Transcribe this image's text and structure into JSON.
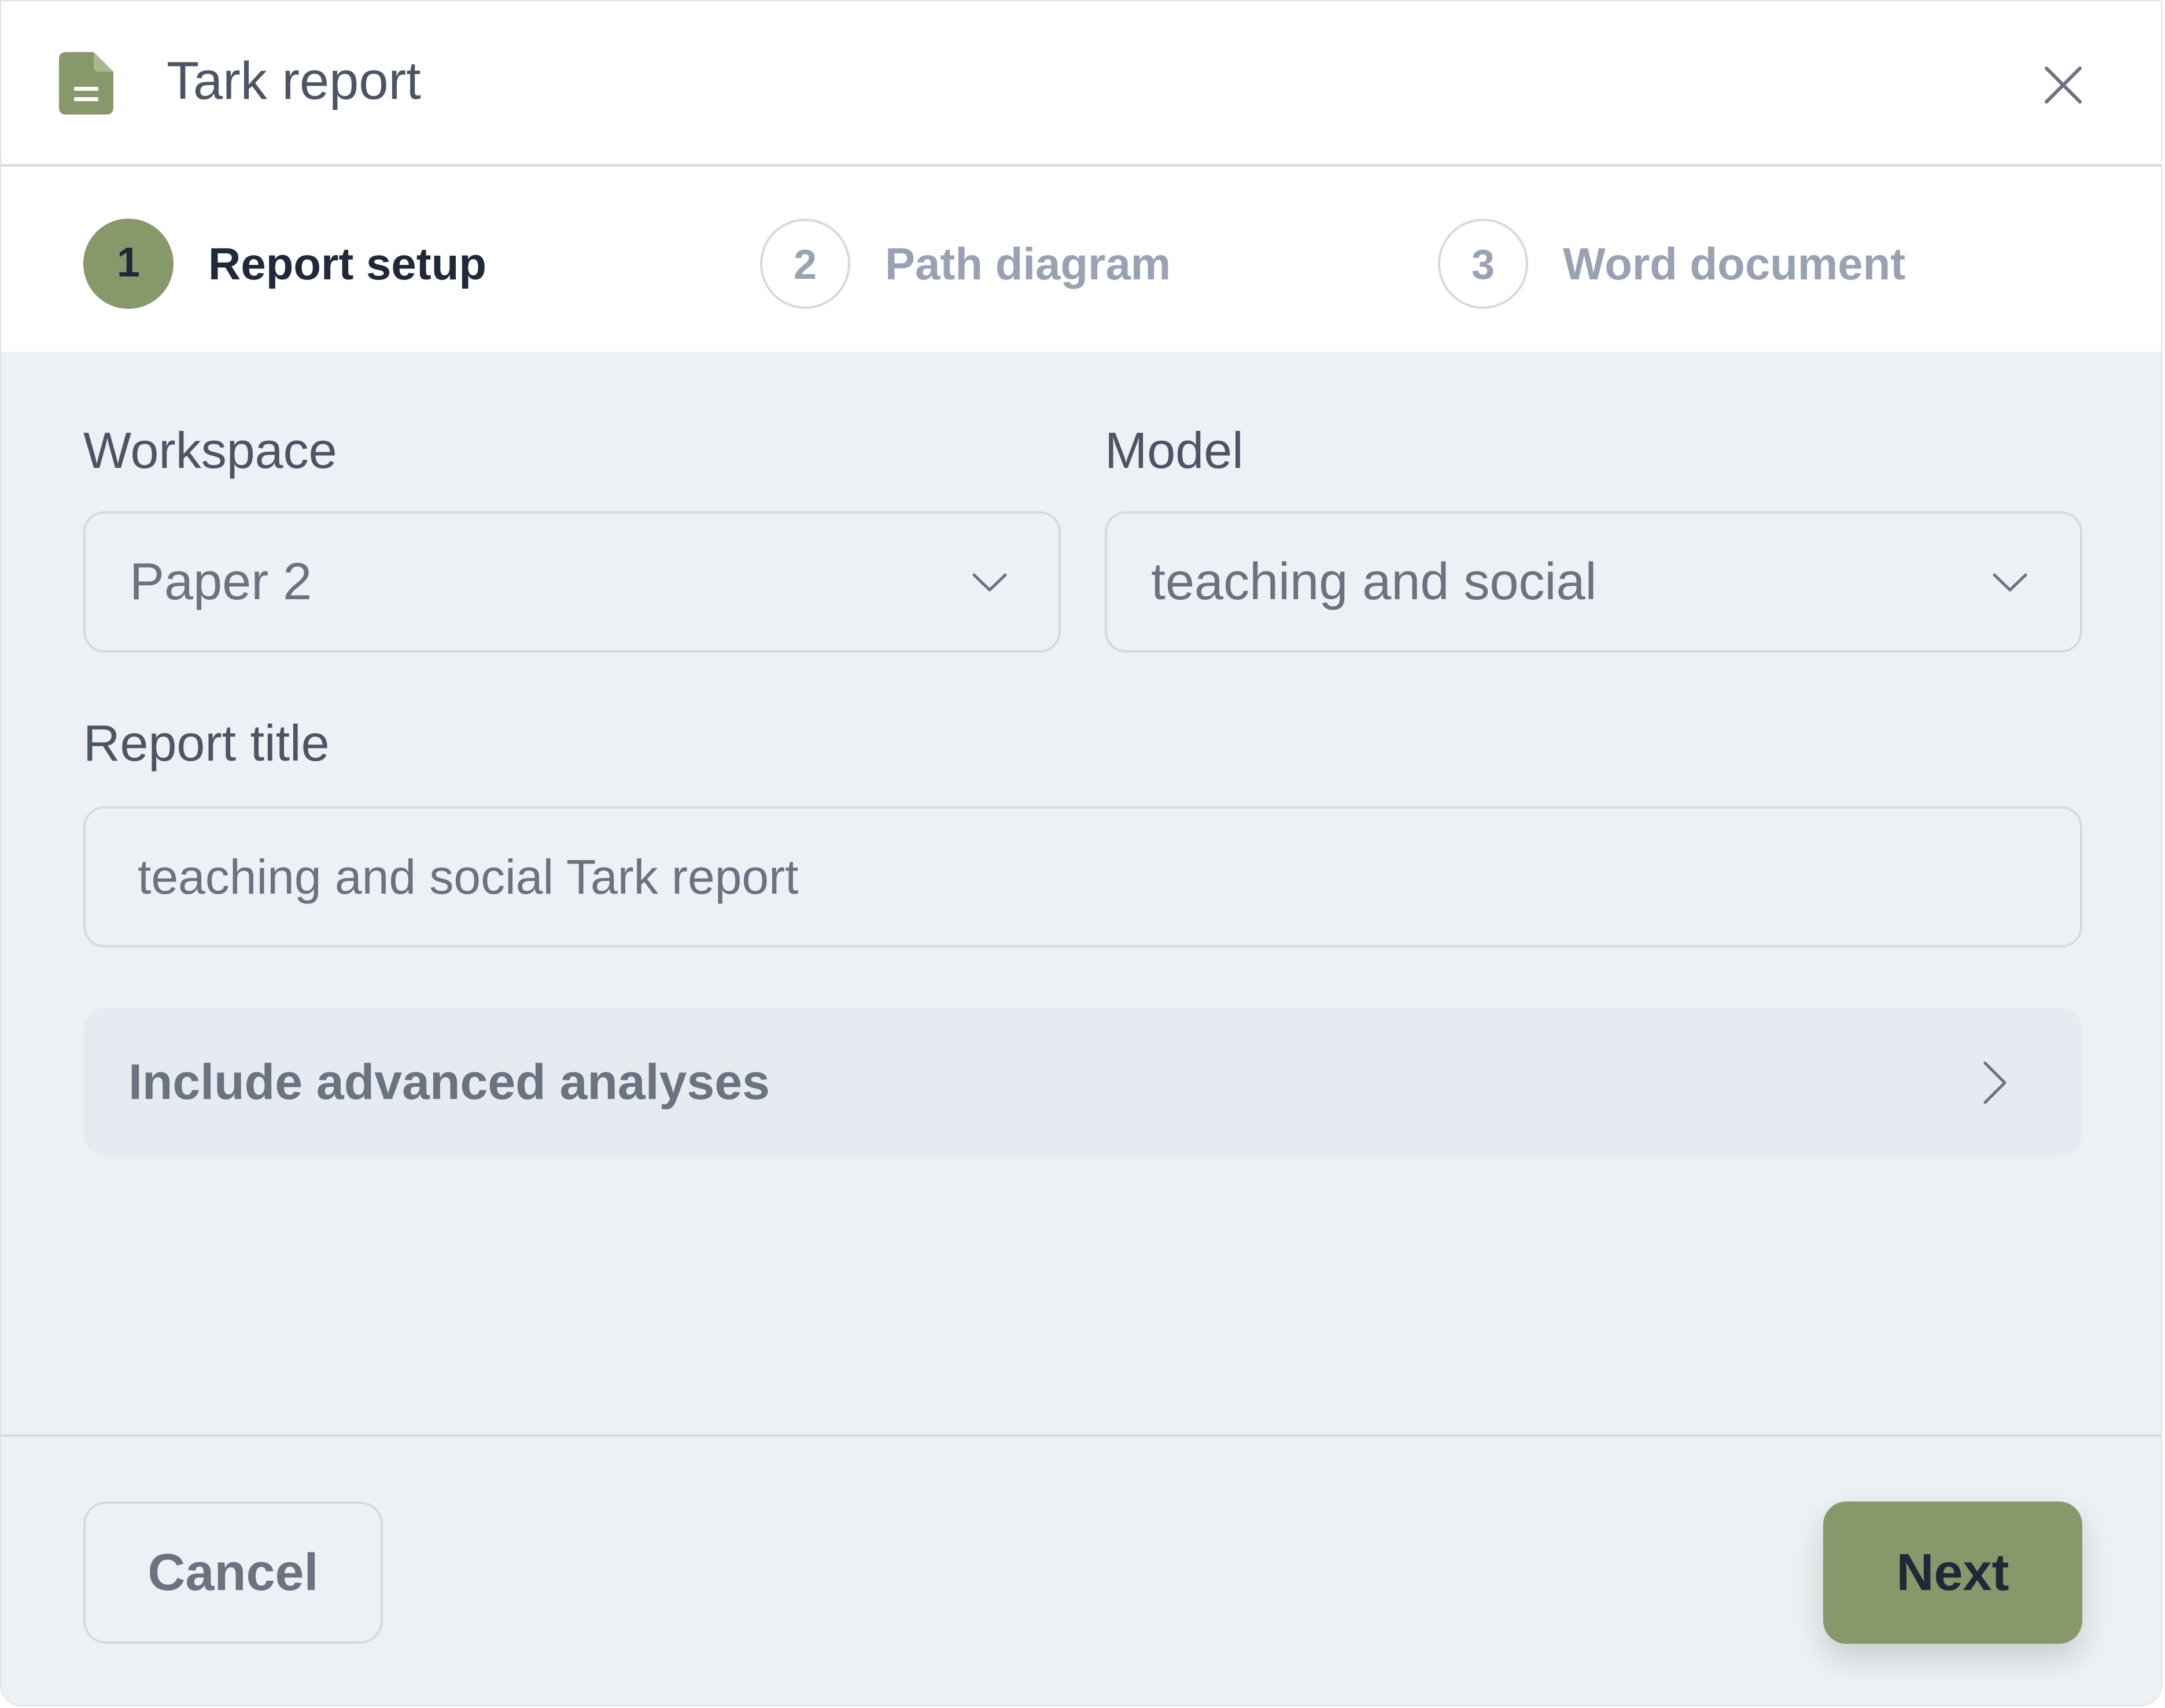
{
  "header": {
    "title": "Tark report",
    "icon": "document-icon",
    "close_icon": "close-icon"
  },
  "stepper": {
    "steps": [
      {
        "number": "1",
        "label": "Report setup",
        "state": "active"
      },
      {
        "number": "2",
        "label": "Path diagram",
        "state": "inactive"
      },
      {
        "number": "3",
        "label": "Word document",
        "state": "inactive"
      }
    ]
  },
  "form": {
    "workspace": {
      "label": "Workspace",
      "value": "Paper 2"
    },
    "model": {
      "label": "Model",
      "value": "teaching and social"
    },
    "report_title": {
      "label": "Report title",
      "value": "teaching and social Tark report"
    },
    "advanced": {
      "label": "Include advanced analyses"
    }
  },
  "footer": {
    "cancel_label": "Cancel",
    "next_label": "Next"
  },
  "colors": {
    "accent": "#87986a",
    "panel_background": "#edf0f4",
    "muted_text": "#98a2b3"
  }
}
